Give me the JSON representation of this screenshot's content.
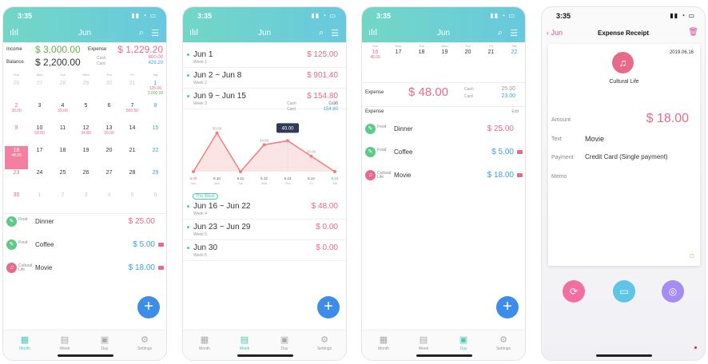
{
  "time": "3:35",
  "month_title": "Jun",
  "tabs": [
    "Month",
    "Week",
    "Day",
    "Settings"
  ],
  "month": {
    "income_label": "Income",
    "income_value": "$ 3,000.00",
    "expense_label": "Expense",
    "expense_value": "$ 1,229.20",
    "cash_label": "Cash",
    "cash_value": "800.00",
    "card_label": "Card",
    "card_value": "429.20",
    "balance_label": "Balance",
    "balance_value": "$ 2,200.00",
    "dow": [
      "Sun",
      "Mon",
      "Tue",
      "Wed",
      "Thu",
      "Fri",
      "Sat"
    ],
    "cells": [
      {
        "d": "26",
        "v": "",
        "c": "off"
      },
      {
        "d": "27",
        "v": "",
        "c": "off"
      },
      {
        "d": "28",
        "v": "",
        "c": "off"
      },
      {
        "d": "29",
        "v": "",
        "c": "off"
      },
      {
        "d": "30",
        "v": "",
        "c": "off"
      },
      {
        "d": "31",
        "v": "",
        "c": "off"
      },
      {
        "d": "1",
        "v": "125.00",
        "v2": "3,000.00",
        "c": "sat"
      },
      {
        "d": "2",
        "v": "",
        "c": "sun"
      },
      {
        "d": "3",
        "v": "",
        "c": ""
      },
      {
        "d": "4",
        "v": "",
        "c": ""
      },
      {
        "d": "5",
        "v": "",
        "c": ""
      },
      {
        "d": "6",
        "v": "",
        "c": ""
      },
      {
        "d": "7",
        "v": "",
        "c": ""
      },
      {
        "d": "8",
        "v": "",
        "c": "sat"
      },
      {
        "d": "9",
        "v": "",
        "c": "sun"
      },
      {
        "d": "10",
        "v": "",
        "c": ""
      },
      {
        "d": "11",
        "v": "",
        "c": ""
      },
      {
        "d": "12",
        "v": "",
        "c": ""
      },
      {
        "d": "13",
        "v": "",
        "c": ""
      },
      {
        "d": "14",
        "v": "",
        "c": ""
      },
      {
        "d": "15",
        "v": "",
        "c": "sat"
      },
      {
        "d": "16",
        "v": "48.00",
        "c": "sun"
      },
      {
        "d": "17",
        "v": "",
        "c": ""
      },
      {
        "d": "18",
        "v": "",
        "c": ""
      },
      {
        "d": "19",
        "v": "",
        "c": ""
      },
      {
        "d": "20",
        "v": "",
        "c": ""
      },
      {
        "d": "21",
        "v": "",
        "c": ""
      },
      {
        "d": "22",
        "v": "",
        "c": "sat"
      },
      {
        "d": "23",
        "v": "",
        "c": "sun"
      },
      {
        "d": "24",
        "v": "",
        "c": ""
      },
      {
        "d": "25",
        "v": "",
        "c": ""
      },
      {
        "d": "26",
        "v": "",
        "c": ""
      },
      {
        "d": "27",
        "v": "",
        "c": ""
      },
      {
        "d": "28",
        "v": "",
        "c": ""
      },
      {
        "d": "29",
        "v": "",
        "c": "sat"
      },
      {
        "d": "30",
        "v": "",
        "c": "sun"
      },
      {
        "d": "1",
        "v": "",
        "c": "off"
      },
      {
        "d": "2",
        "v": "",
        "c": "off"
      },
      {
        "d": "3",
        "v": "",
        "c": "off"
      },
      {
        "d": "4",
        "v": "",
        "c": "off"
      },
      {
        "d": "5",
        "v": "",
        "c": "off"
      },
      {
        "d": "6",
        "v": "",
        "c": "off"
      }
    ],
    "cell_values": {
      "row1": [
        "",
        "",
        "",
        "",
        "",
        "",
        "125.00 / 3,000.00"
      ],
      "row2": [
        "30.00",
        "",
        "55.00",
        "",
        "",
        "560.50",
        ""
      ],
      "row3": [
        "",
        "50.00",
        "",
        "34.80",
        "20.00",
        "",
        ""
      ],
      "row4": [
        "48.00",
        "",
        "",
        "",
        "",
        "",
        ""
      ]
    }
  },
  "expenses": [
    {
      "cat": "Food",
      "name": "Dinner",
      "amount": "$ 25.00",
      "color": "#e86a8a",
      "card": false
    },
    {
      "cat": "Food",
      "name": "Coffee",
      "amount": "$ 5.00",
      "color": "#3ba3dc",
      "card": true
    },
    {
      "cat": "Cultural Life",
      "name": "Movie",
      "amount": "$ 18.00",
      "color": "#3ba3dc",
      "card": true
    }
  ],
  "weeks_top": [
    {
      "title": "Jun 1",
      "sub": "Week 1",
      "amount": "$ 125.00"
    },
    {
      "title": "Jun 2 ~ Jun 8",
      "sub": "Week 2",
      "amount": "$ 901.40"
    },
    {
      "title": "Jun 9 ~ Jun 15",
      "sub": "Week 3",
      "amount": "$ 154.80"
    }
  ],
  "week3_cash_label": "Cash",
  "week3_cash": "0.00",
  "week3_card_label": "Card",
  "week3_card": "154.80",
  "weeks_bottom": [
    {
      "title": "Jun 16 ~ Jun 22",
      "sub": "Week 4",
      "amount": "$ 48.00"
    },
    {
      "title": "Jun 23 ~ Jun 29",
      "sub": "Week 5",
      "amount": "$ 0.00"
    },
    {
      "title": "Jun 30",
      "sub": "Week 6",
      "amount": "$ 0.00"
    }
  ],
  "this_week_badge": "This Week",
  "chart_data": {
    "type": "line",
    "categories": [
      "6.09",
      "6.10",
      "6.11",
      "6.12",
      "6.13",
      "6.14",
      "6.15"
    ],
    "day_labels": [
      "Sun",
      "Mon",
      "Tue",
      "Wed",
      "Thu",
      "Fri",
      "Sat"
    ],
    "values": [
      0,
      50.0,
      0,
      34.8,
      40.0,
      20.0,
      0
    ],
    "point_labels": [
      "",
      "50.00",
      "",
      "34.80",
      "",
      "20.00",
      ""
    ],
    "highlight": "40.00",
    "ylim": [
      0,
      60
    ]
  },
  "day": {
    "dow": [
      "Sun",
      "Mon",
      "Tue",
      "Wed",
      "Thu",
      "Fri",
      "Sat"
    ],
    "days": [
      "16",
      "17",
      "18",
      "19",
      "20",
      "21",
      "22"
    ],
    "sel_value": "48.00",
    "expense_label": "Expense",
    "expense_total": "$ 48.00",
    "cash_label": "Cash",
    "cash": "25.00",
    "card_label": "Card",
    "card": "23.00",
    "list_label": "Expense",
    "edit_label": "Edit"
  },
  "receipt": {
    "back": "Jun",
    "title": "Expense Receipt",
    "date": "2019.06.16",
    "category": "Cultural Life",
    "amount_label": "Amount",
    "amount": "$ 18.00",
    "text_label": "Text",
    "text": "Movie",
    "payment_label": "Payment",
    "payment": "Credit Card (Single payment)",
    "memo_label": "Memo"
  },
  "colors": {
    "accent": "#4fc7b5",
    "pink": "#e86a8a",
    "blue": "#3ba3dc",
    "green": "#5fb548"
  }
}
